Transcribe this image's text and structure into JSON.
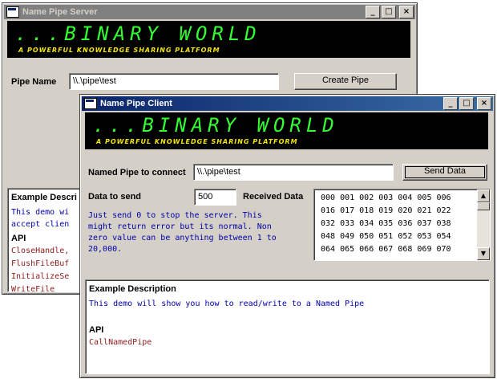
{
  "server": {
    "title": "Name Pipe Server",
    "banner_big": "...BINARY WORLD",
    "banner_small": "A POWERFUL KNOWLEDGE SHARING PLATFORM",
    "pipe_name_label": "Pipe Name",
    "pipe_name_value": "\\\\.\\pipe\\test",
    "create_button": "Create Pipe",
    "desc_heading": "Example Descri",
    "desc_lines": [
      "This demo wi",
      "accept clien"
    ],
    "api_heading": "API",
    "api_lines": [
      "CloseHandle,",
      "FlushFileBuf",
      "InitializeSe",
      "WriteFile"
    ]
  },
  "client": {
    "title": "Name Pipe Client",
    "banner_big": "...BINARY WORLD",
    "banner_small": "A POWERFUL KNOWLEDGE SHARING PLATFORM",
    "connect_label": "Named Pipe to connect",
    "connect_value": "\\\\.\\pipe\\test",
    "send_button": "Send Data",
    "data_label": "Data to send",
    "data_value": "500",
    "received_label": "Received Data",
    "hint_lines": [
      "Just send 0 to stop the server. This",
      "might return error but its normal. Non",
      "zero value can be anything between 1 to",
      "20,000."
    ],
    "received_rows": [
      "000 001 002 003 004 005 006",
      "016 017 018 019 020 021 022",
      "032 033 034 035 036 037 038",
      "048 049 050 051 052 053 054",
      "064 065 066 067 068 069 070"
    ],
    "desc_heading": "Example Description",
    "desc_text": "This demo will show you how to read/write to a Named Pipe",
    "api_heading": "API",
    "api_text": "CallNamedPipe"
  },
  "caption_buttons": {
    "minimize": "_",
    "maximize": "□",
    "close": "×"
  },
  "scroll": {
    "up": "▲",
    "down": "▼"
  },
  "colors": {
    "banner_green": "#33ff33",
    "banner_yellow": "#f2e600",
    "active_title": "#0a246a",
    "inactive_title": "#808080",
    "blue_text": "#0000aa",
    "api_text": "#8b1a1a"
  }
}
